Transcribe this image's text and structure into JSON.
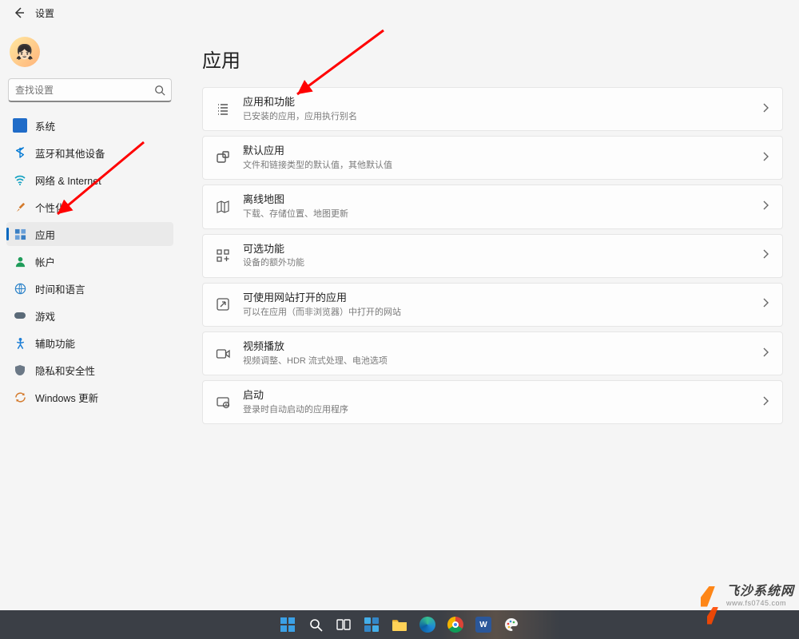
{
  "header": {
    "title": "设置"
  },
  "search": {
    "placeholder": "查找设置"
  },
  "sidebar": {
    "items": [
      {
        "label": "系统"
      },
      {
        "label": "蓝牙和其他设备"
      },
      {
        "label": "网络 & Internet"
      },
      {
        "label": "个性化"
      },
      {
        "label": "应用"
      },
      {
        "label": "帐户"
      },
      {
        "label": "时间和语言"
      },
      {
        "label": "游戏"
      },
      {
        "label": "辅助功能"
      },
      {
        "label": "隐私和安全性"
      },
      {
        "label": "Windows 更新"
      }
    ]
  },
  "page": {
    "title": "应用",
    "cards": [
      {
        "title": "应用和功能",
        "sub": "已安装的应用，应用执行别名"
      },
      {
        "title": "默认应用",
        "sub": "文件和链接类型的默认值，其他默认值"
      },
      {
        "title": "离线地图",
        "sub": "下载、存储位置、地图更新"
      },
      {
        "title": "可选功能",
        "sub": "设备的额外功能"
      },
      {
        "title": "可使用网站打开的应用",
        "sub": "可以在应用（而非浏览器）中打开的网站"
      },
      {
        "title": "视频播放",
        "sub": "视频调整、HDR 流式处理、电池选项"
      },
      {
        "title": "启动",
        "sub": "登录时自动启动的应用程序"
      }
    ]
  },
  "watermark": {
    "cn": "飞沙系统网",
    "en": "www.fs0745.com"
  }
}
